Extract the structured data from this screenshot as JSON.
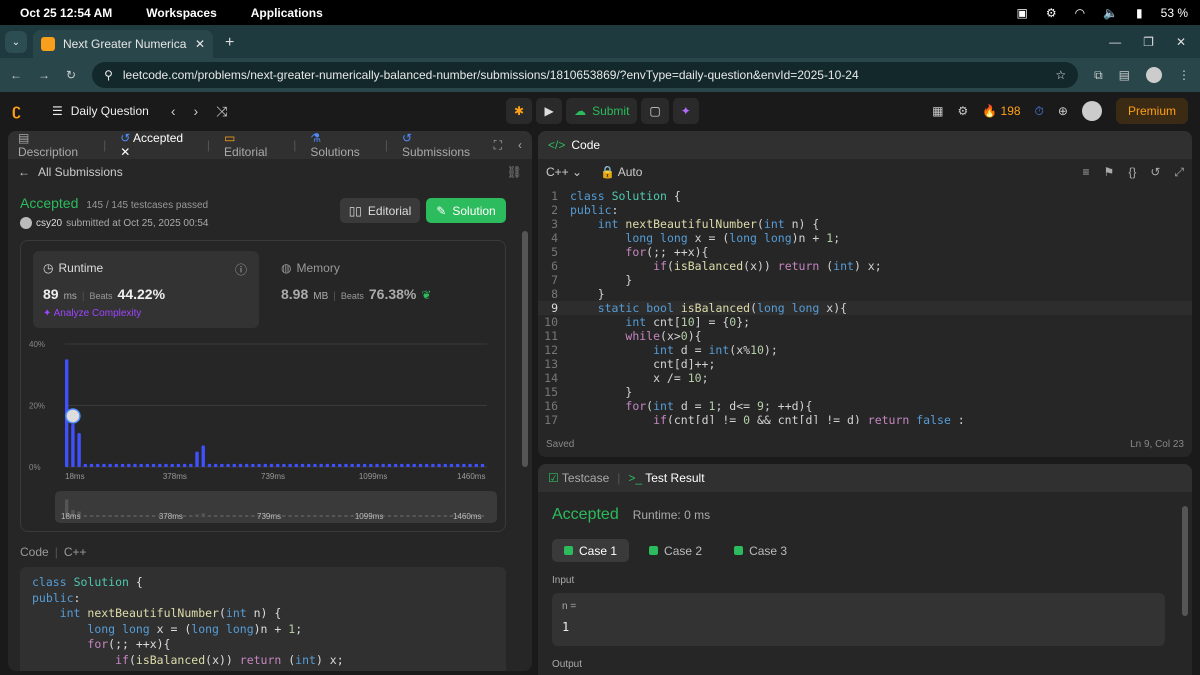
{
  "os": {
    "datetime": "Oct 25  12:54 AM",
    "workspaces": "Workspaces",
    "applications": "Applications",
    "battery": "53 %"
  },
  "browser": {
    "tab_title": "Next Greater Numerically Ba",
    "url": "leetcode.com/problems/next-greater-numerically-balanced-number/submissions/1810653869/?envType=daily-question&envId=2025-10-24"
  },
  "nav": {
    "daily": "Daily Question",
    "submit": "Submit",
    "streak": "198",
    "premium": "Premium"
  },
  "left": {
    "tabs": [
      "Description",
      "Accepted",
      "Editorial",
      "Solutions",
      "Submissions"
    ],
    "all_submissions": "All Submissions",
    "status": "Accepted",
    "testcases": "145 / 145 testcases passed",
    "user": "csy20",
    "submitted_at": "submitted at Oct 25, 2025 00:54",
    "editorial_btn": "Editorial",
    "solution_btn": "Solution",
    "runtime_label": "Runtime",
    "runtime_value": "89",
    "runtime_unit": "ms",
    "beats_label": "Beats",
    "runtime_beats": "44.22%",
    "analyze": "Analyze Complexity",
    "memory_label": "Memory",
    "memory_value": "8.98",
    "memory_unit": "MB",
    "memory_beats": "76.38%",
    "code_label": "Code",
    "lang": "C++",
    "code_lines": [
      "class Solution {",
      "public:",
      "    int nextBeautifulNumber(int n) {",
      "        long long x = (long long)n + 1;",
      "        for(;; ++x){",
      "            if(isBalanced(x)) return (int) x;"
    ]
  },
  "chart_data": {
    "type": "bar",
    "title": "",
    "ylabel": "",
    "xlabel": "",
    "yticks": [
      "40%",
      "20%",
      "0%"
    ],
    "ylim": [
      0,
      40
    ],
    "xticks": [
      "18ms",
      "378ms",
      "739ms",
      "1099ms",
      "1460ms"
    ],
    "x_range": [
      18,
      1460
    ],
    "values": [
      35,
      14,
      11,
      1,
      1,
      1,
      1,
      1,
      1,
      1,
      1,
      1,
      1,
      1,
      1,
      1,
      1,
      1,
      1,
      1,
      1,
      5,
      7,
      1,
      1,
      1,
      1,
      1,
      1,
      1,
      1,
      1,
      1,
      1,
      1,
      1,
      1,
      1,
      1,
      1,
      1,
      1,
      1,
      1,
      1,
      1,
      1,
      1,
      1,
      1,
      1,
      1,
      1,
      1,
      1,
      1,
      1,
      1,
      1,
      1,
      1,
      1,
      1,
      1,
      1,
      1,
      1,
      1
    ],
    "user_bar_index": 1,
    "highlight_color": "#3f51ff",
    "grid": true
  },
  "code": {
    "title": "Code",
    "lang": "C++",
    "mode": "Auto",
    "saved": "Saved",
    "cursor": "Ln 9, Col 23",
    "current_line": 9,
    "lines": [
      "class Solution {",
      "public:",
      "    int nextBeautifulNumber(int n) {",
      "        long long x = (long long)n + 1;",
      "        for(;; ++x){",
      "            if(isBalanced(x)) return (int) x;",
      "        }",
      "    }",
      "    static bool isBalanced(long long x){",
      "        int cnt[10] = {0};",
      "        while(x>0){",
      "            int d = int(x%10);",
      "            cnt[d]++;",
      "            x /= 10;",
      "        }",
      "        for(int d = 1; d<= 9; ++d){",
      "            if(cnt[d] != 0 && cnt[d] != d) return false ;"
    ]
  },
  "test": {
    "tab_testcase": "Testcase",
    "tab_result": "Test Result",
    "status": "Accepted",
    "runtime": "Runtime: 0 ms",
    "cases": [
      "Case 1",
      "Case 2",
      "Case 3"
    ],
    "input_label": "Input",
    "var_name": "n =",
    "var_value": "1",
    "output_label": "Output"
  }
}
